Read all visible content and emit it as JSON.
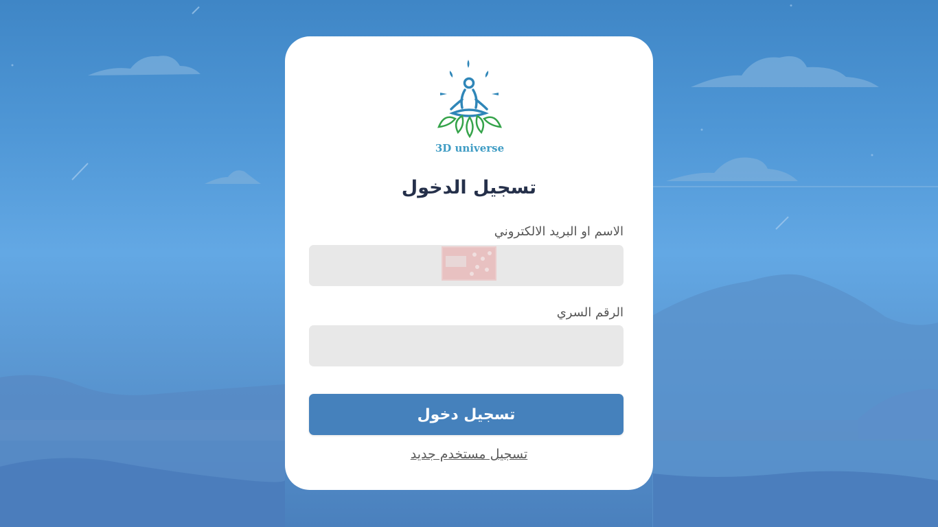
{
  "app": {
    "brand_name": "3D universe"
  },
  "login": {
    "title": "تسجيل الدخول",
    "username_label": "الاسم او البريد الالكتروني",
    "username_value": "",
    "username_placeholder": "",
    "password_label": "الرقم السري",
    "password_value": "",
    "password_placeholder": "",
    "submit_label": "تسجيل دخول",
    "register_link": "تسجيل مستخدم جديد"
  },
  "icons": {
    "logo": "meditation-lotus-logo",
    "field_badge": "autofill-badge-icon"
  },
  "colors": {
    "accent": "#4581bc",
    "title": "#25304a",
    "field_bg": "#e8e8e8",
    "logo_blue": "#2f86b8",
    "logo_green": "#35a34a"
  }
}
